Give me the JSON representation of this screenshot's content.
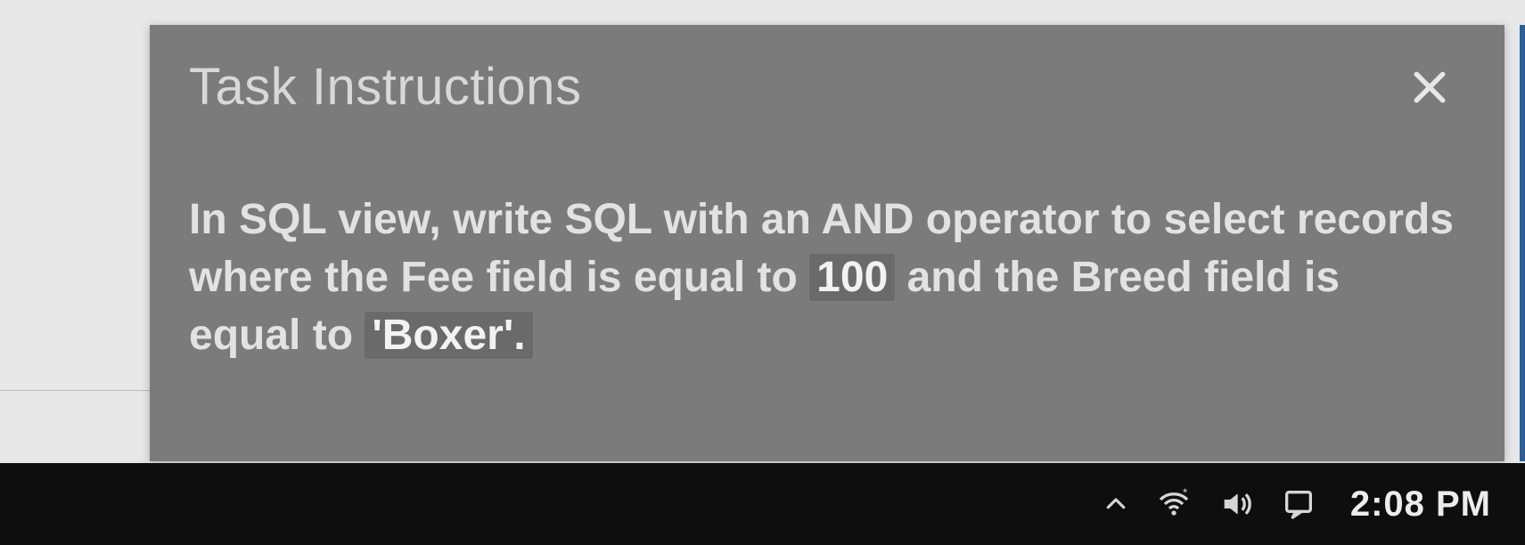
{
  "panel": {
    "title": "Task Instructions",
    "body": {
      "pre1": "In SQL view, write SQL with an AND operator to select records where the Fee field is equal to ",
      "val1": "100",
      "mid1": " and the Breed field is equal to ",
      "val2": "'Boxer'.",
      "post": ""
    }
  },
  "taskbar": {
    "time": "2:08 PM"
  }
}
